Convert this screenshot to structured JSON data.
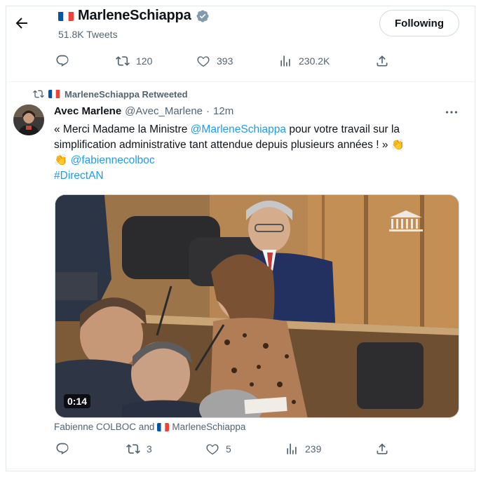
{
  "header": {
    "name": "MarleneSchiappa",
    "tweet_count": "51.8K Tweets",
    "follow_label": "Following"
  },
  "prev_tweet": {
    "retweets": "120",
    "likes": "393",
    "views": "230.2K"
  },
  "retweet_context": {
    "label": "MarleneSchiappa Retweeted"
  },
  "tweet": {
    "display_name": "Avec Marlene",
    "handle": "@Avec_Marlene",
    "sep": "·",
    "time": "12m",
    "text_part1": "« Merci Madame la Ministre ",
    "mention1": "@MarleneSchiappa",
    "text_part2": " pour votre travail sur la simplification administrative tant attendue depuis plusieurs années ! » ",
    "emoji": "👏",
    "mention2": "@fabiennecolboc",
    "hashtag": "#DirectAN",
    "video_time": "0:14",
    "tagged_text": "Fabienne COLBOC and",
    "tagged_user": "MarleneSchiappa",
    "replies": "",
    "retweets": "3",
    "likes": "5",
    "views": "239"
  },
  "colors": {
    "accent": "#1d9bf0",
    "muted": "#536471",
    "text": "#0f1419"
  },
  "icons": [
    "back-arrow-icon",
    "france-flag-icon",
    "verified-badge-icon",
    "reply-icon",
    "retweet-icon",
    "like-icon",
    "views-icon",
    "share-icon",
    "more-icon",
    "assembly-logo-icon"
  ]
}
